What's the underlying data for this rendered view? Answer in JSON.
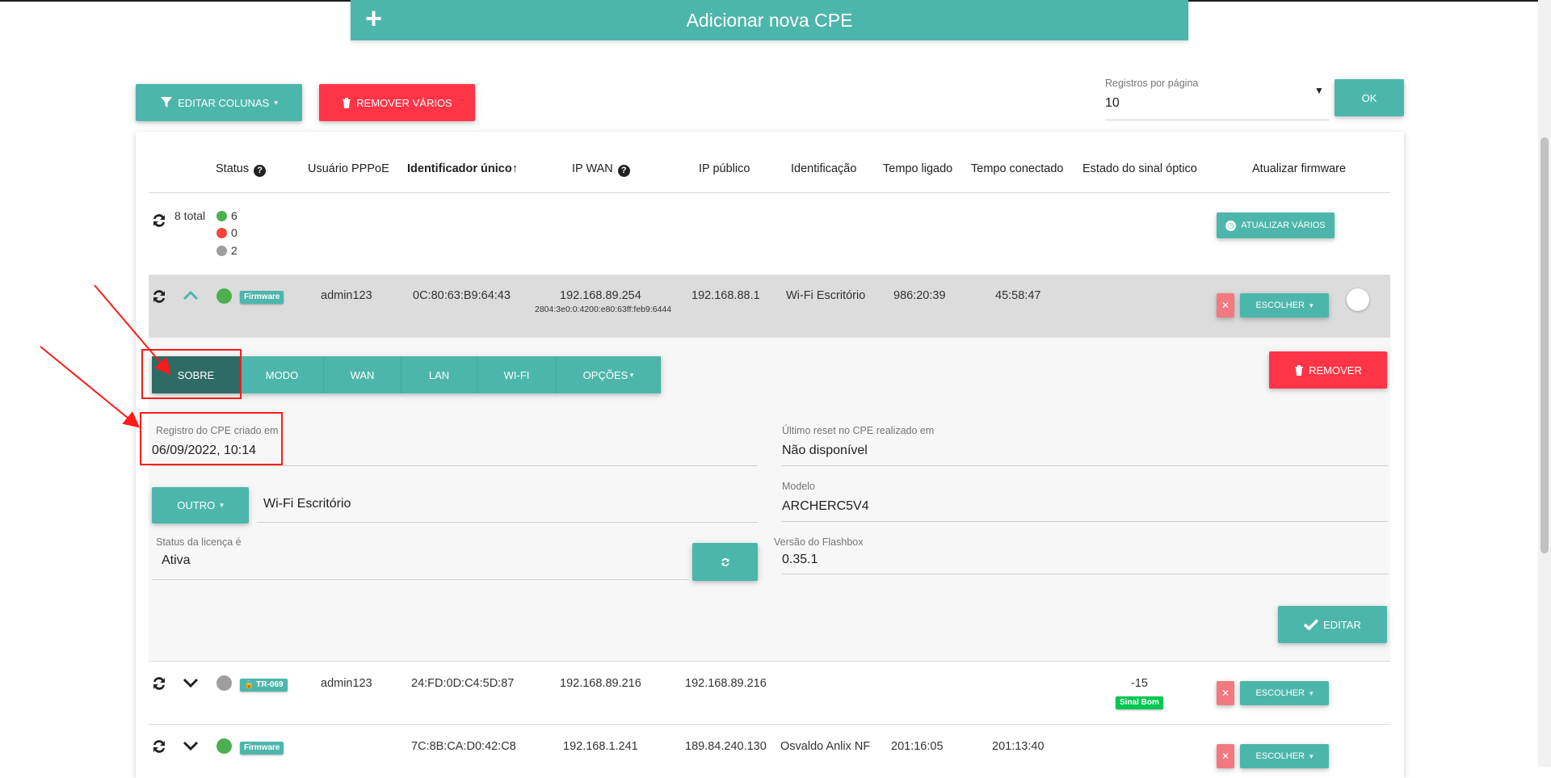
{
  "header": {
    "add_cpe": "Adicionar nova CPE"
  },
  "toolbar": {
    "edit_columns": "EDITAR COLUNAS",
    "remove_many": "REMOVER VÁRIOS",
    "per_page_label": "Registros por página",
    "per_page_value": "10",
    "ok": "OK"
  },
  "table": {
    "headers": {
      "status": "Status",
      "pppoe": "Usuário PPPoE",
      "uid": "Identificador único↑",
      "ipwan": "IP WAN",
      "ippub": "IP público",
      "ident": "Identificação",
      "uptime": "Tempo ligado",
      "conntime": "Tempo conectado",
      "optical": "Estado do sinal óptico",
      "firmware": "Atualizar firmware"
    },
    "summary": {
      "total": "8 total",
      "online": "6",
      "offline": "0",
      "unknown": "2",
      "update_many": "ATUALIZAR VÁRIOS"
    },
    "rows": [
      {
        "badge": "Firmware",
        "pppoe": "admin123",
        "uid": "0C:80:63:B9:64:43",
        "ipwan": "192.168.89.254",
        "ipv6": "2804:3e0:0:4200:e80:63ff:feb9:6444",
        "ippub": "192.168.88.1",
        "ident": "Wi-Fi Escritório",
        "uptime": "986:20:39",
        "conntime": "45:58:47",
        "choose": "ESCOLHER"
      },
      {
        "badge": "TR-069",
        "pppoe": "admin123",
        "uid": "24:FD:0D:C4:5D:87",
        "ipwan": "192.168.89.216",
        "ippub": "192.168.89.216",
        "optical_value": "-15",
        "optical_badge": "Sinal Bom",
        "choose": "ESCOLHER"
      },
      {
        "badge": "Firmware",
        "uid": "7C:8B:CA:D0:42:C8",
        "ipwan": "192.168.1.241",
        "ippub": "189.84.240.130",
        "ident": "Osvaldo Anlix NF",
        "uptime": "201:16:05",
        "conntime": "201:13:40",
        "choose": "ESCOLHER"
      }
    ]
  },
  "detail": {
    "tabs": [
      "SOBRE",
      "MODO",
      "WAN",
      "LAN",
      "WI-FI",
      "OPÇÕES"
    ],
    "remove": "REMOVER",
    "created_label": "Registro do CPE criado em",
    "created_value": "06/09/2022, 10:14",
    "reset_label": "Último reset no CPE realizado em",
    "reset_value": "Não disponível",
    "other_button": "OUTRO",
    "other_value": "Wi-Fi Escritório",
    "model_label": "Modelo",
    "model_value": "ARCHERC5V4",
    "license_label": "Status da licença é",
    "license_value": "Ativa",
    "flashbox_label": "Versão do Flashbox",
    "flashbox_value": "0.35.1",
    "edit": "EDITAR"
  },
  "colors": {
    "teal": "#4db6ac",
    "teal_dark": "#2e6b65",
    "red": "#ff3547",
    "annotation": "#ff1a1a"
  }
}
